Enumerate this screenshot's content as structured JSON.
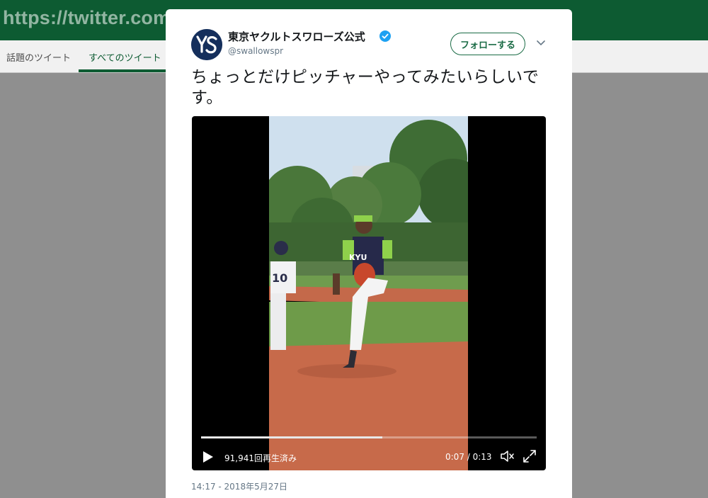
{
  "browser": {
    "url_text": "https://twitter.com/s"
  },
  "page_tabs": [
    {
      "label": "話題のツイート"
    },
    {
      "label": "すべてのツイート"
    }
  ],
  "tweet": {
    "display_name": "東京ヤクルトスワローズ公式",
    "handle": "@swallowspr",
    "verified": true,
    "follow_label": "フォローする",
    "text": "ちょっとだけピッチャーやってみたいらしいです。",
    "timestamp": "14:17 - 2018年5月27日"
  },
  "video": {
    "views_label": "91,941回再生済み",
    "time_label": "0:07 / 0:13",
    "progress": 0.54,
    "icons": [
      "play-icon",
      "volume-icon",
      "fullscreen-icon"
    ]
  },
  "colors": {
    "brand_green": "#0d5b32",
    "verified_blue": "#1da1f2",
    "page_gray": "#8f8f8f"
  }
}
